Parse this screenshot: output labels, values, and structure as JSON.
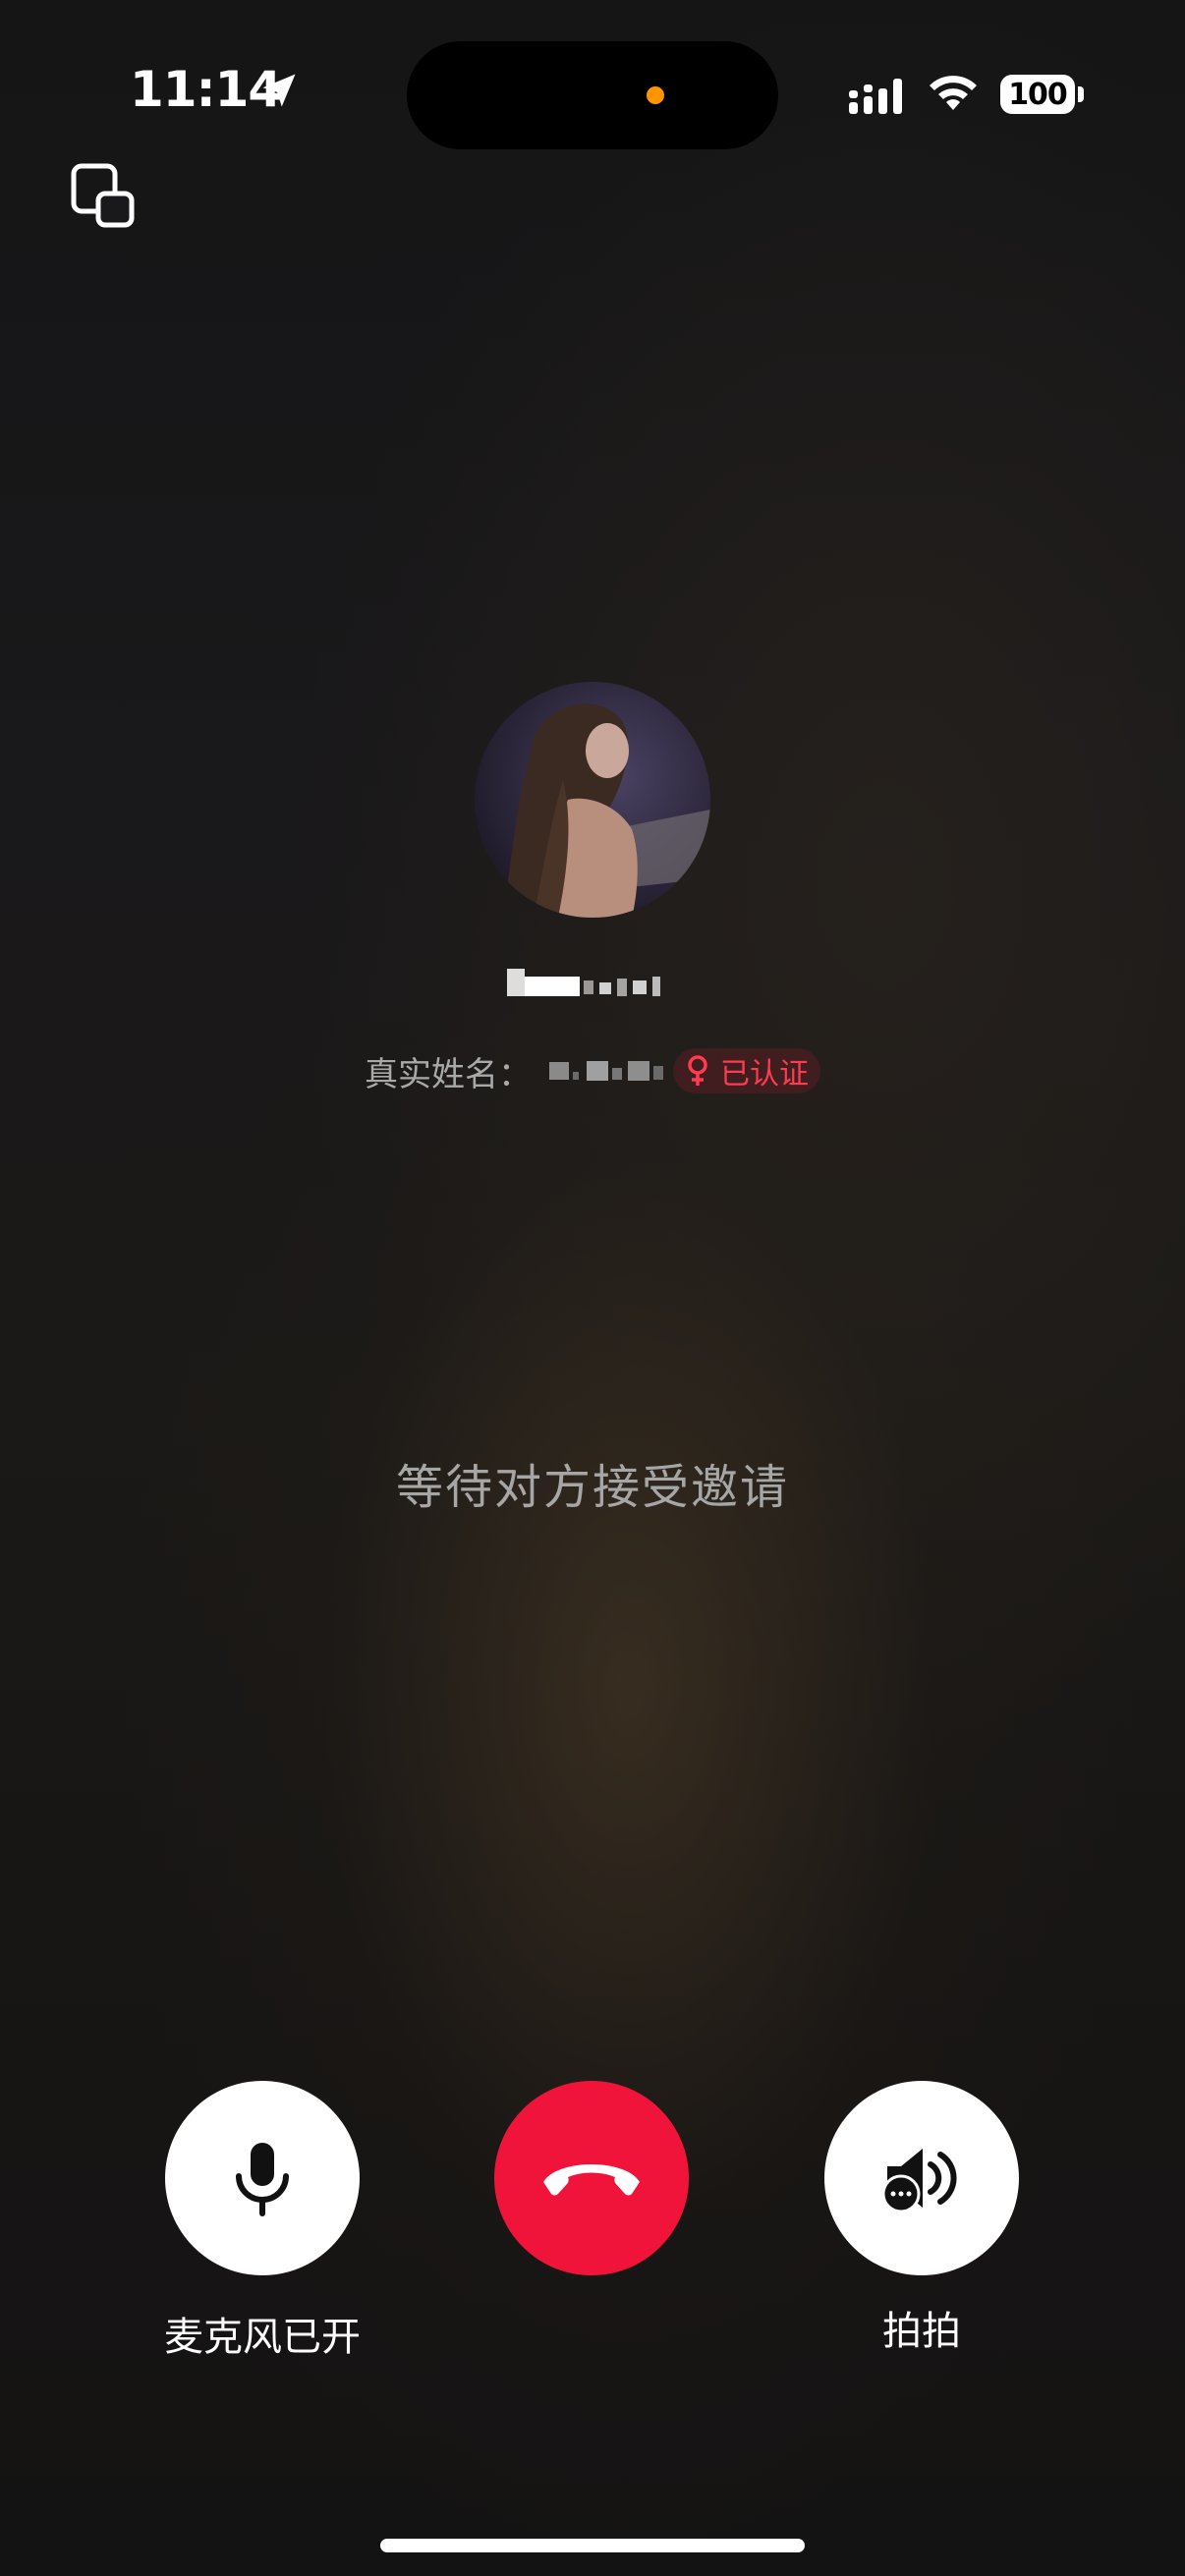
{
  "status_bar": {
    "time": "11:14",
    "battery": "100",
    "icons": [
      "location-arrow-icon",
      "cellular-signal-icon",
      "wifi-icon",
      "battery-icon"
    ]
  },
  "colors": {
    "background": "#151516",
    "hangup_red": "#f0143a",
    "verified_red": "#ff3b52",
    "island_dot": "#ff9500"
  },
  "profile": {
    "real_name_label": "真实姓名：",
    "verified_label": "已认证",
    "gender_icon": "female-icon"
  },
  "call": {
    "status_text": "等待对方接受邀请"
  },
  "controls": {
    "mic_label": "麦克风已开",
    "pai_label": "拍拍"
  }
}
